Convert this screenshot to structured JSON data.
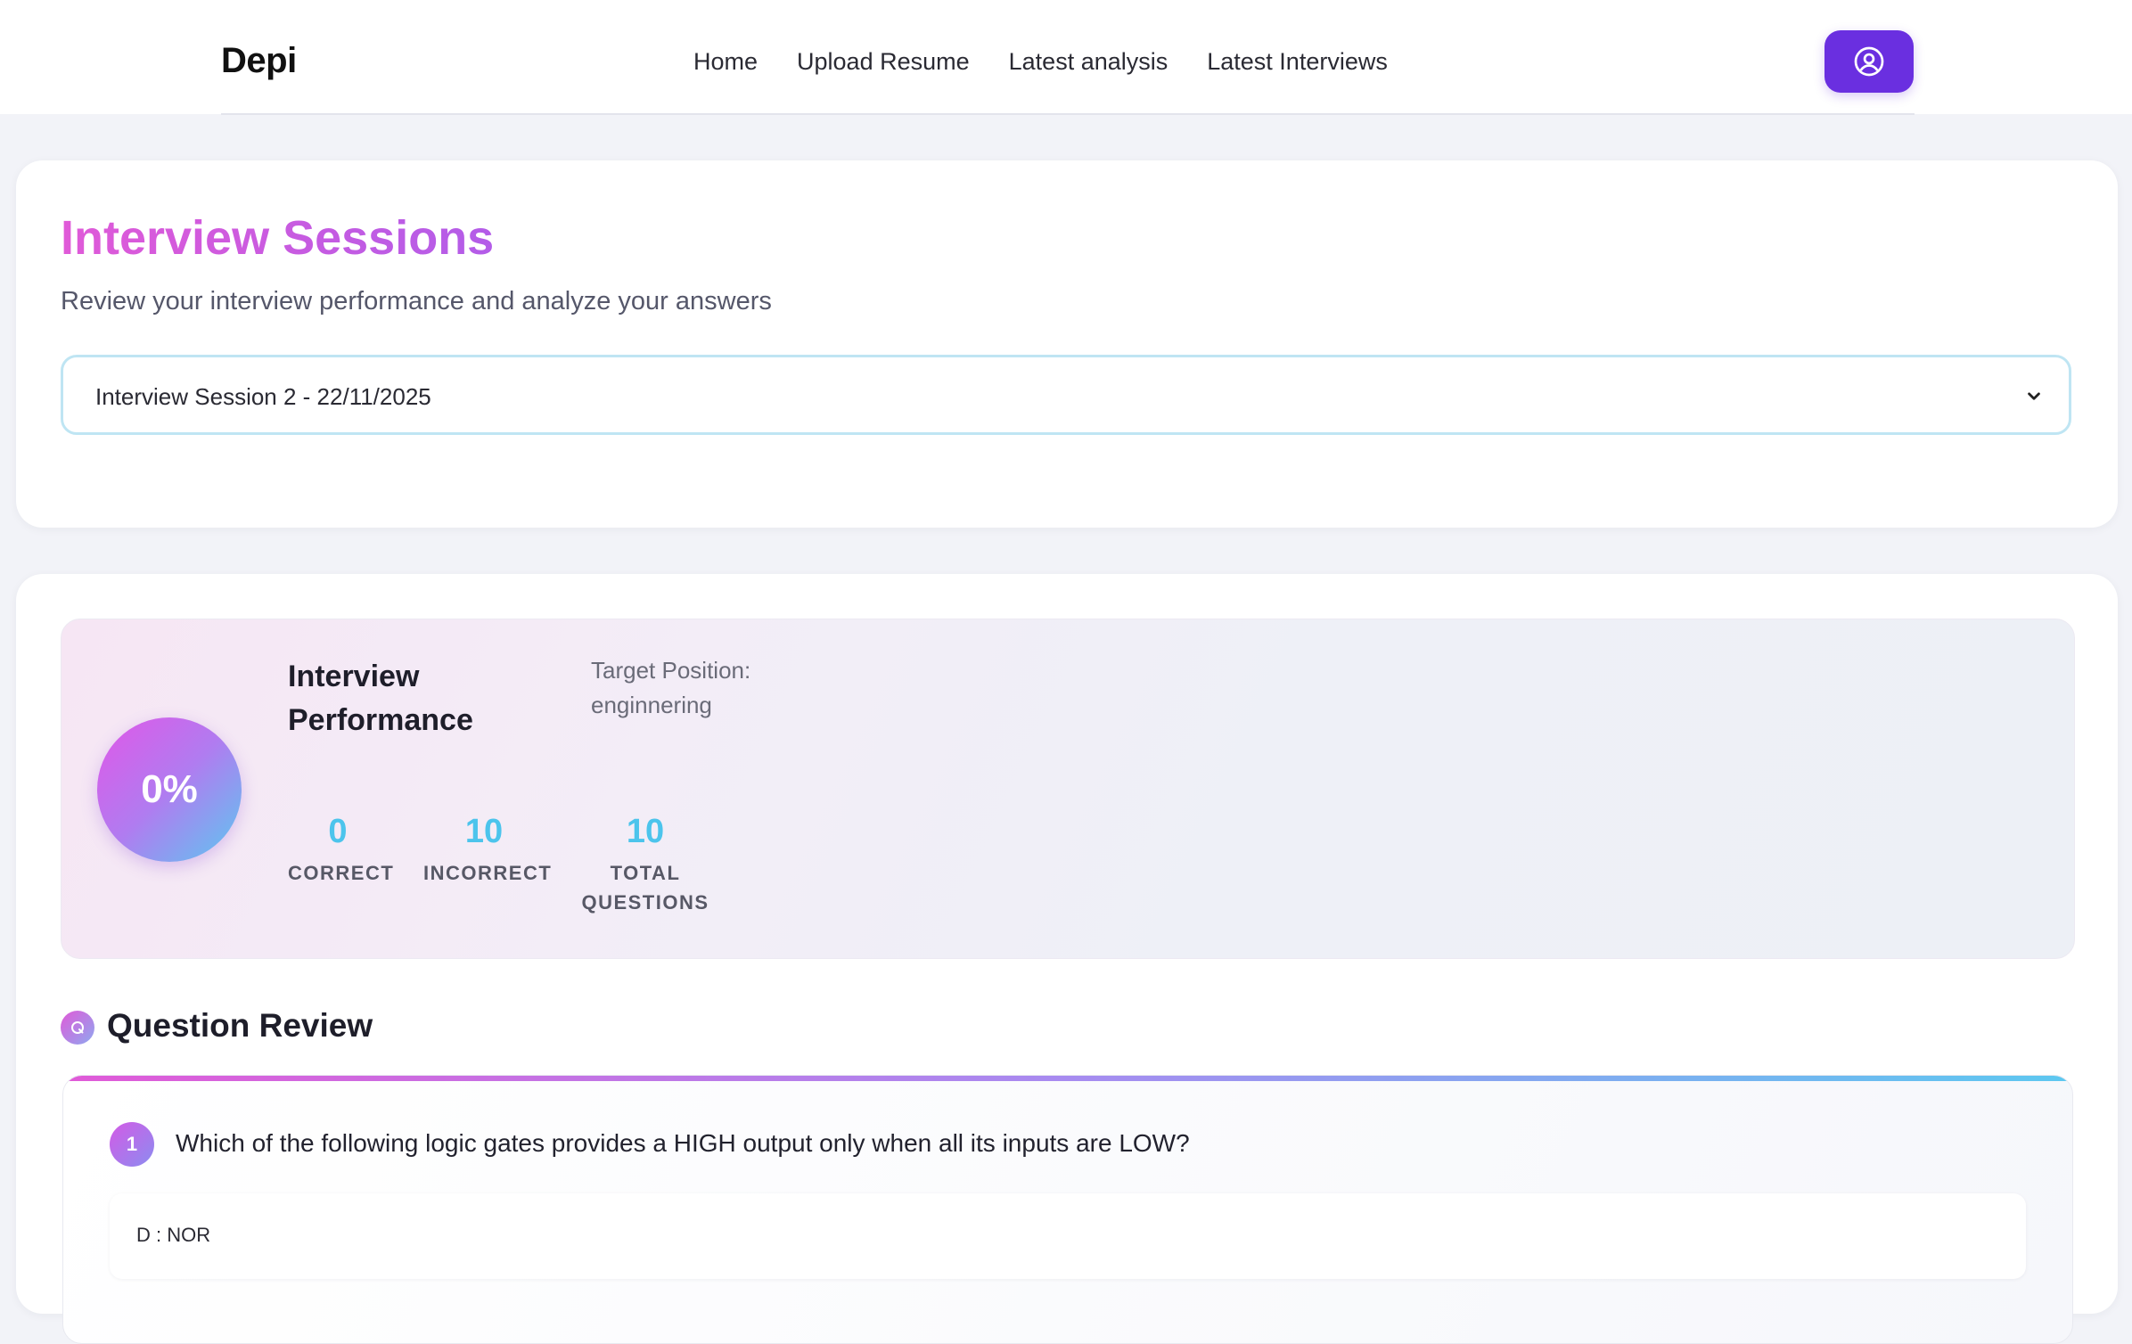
{
  "nav": {
    "brand": "Depi",
    "links": [
      "Home",
      "Upload Resume",
      "Latest analysis",
      "Latest Interviews"
    ],
    "profile_icon": "user-circle-icon"
  },
  "header": {
    "title": "Interview Sessions",
    "subtitle": "Review your interview performance and analyze your answers"
  },
  "session_select": {
    "selected": "Interview Session 2 - 22/11/2025",
    "icon": "chevron-down-icon"
  },
  "performance": {
    "score": "0%",
    "title": "Interview Performance",
    "target_label": "Target Position:",
    "target_value": "enginnering",
    "stats": {
      "correct": {
        "value": "0",
        "label": "CORRECT"
      },
      "incorrect": {
        "value": "10",
        "label": "INCORRECT"
      },
      "total": {
        "value": "10",
        "label": "TOTAL QUESTIONS"
      }
    }
  },
  "question_review": {
    "title": "Question Review",
    "icon_letter": "Q",
    "questions": [
      {
        "number": "1",
        "text": "Which of the following logic gates provides a HIGH output only when all its inputs are LOW?",
        "answer": "D : NOR"
      }
    ]
  },
  "colors": {
    "accent_purple": "#6a2fe0",
    "title_pink": "#e05ad8",
    "stat_cyan": "#4cc4ec"
  }
}
